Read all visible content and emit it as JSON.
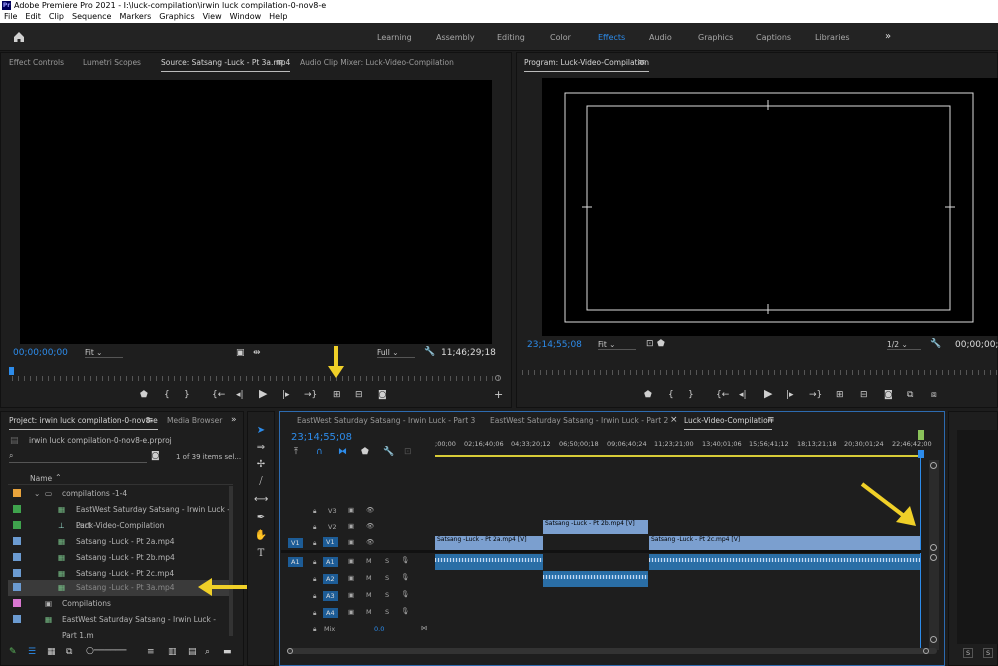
{
  "app": {
    "title": "Adobe Premiere Pro 2021 - I:\\luck-compilation\\irwin luck compilation-0-nov8-e"
  },
  "menu": [
    "File",
    "Edit",
    "Clip",
    "Sequence",
    "Markers",
    "Graphics",
    "View",
    "Window",
    "Help"
  ],
  "workspaces": [
    "Learning",
    "Assembly",
    "Editing",
    "Color",
    "Effects",
    "Audio",
    "Graphics",
    "Captions",
    "Libraries"
  ],
  "active_workspace": "Effects",
  "source_panel": {
    "tabs": [
      "Effect Controls",
      "Lumetri Scopes",
      "Source: Satsang -Luck - Pt 3a.mp4",
      "Audio Clip Mixer: Luck-Video-Compilation"
    ],
    "timecode_in": "00;00;00;00",
    "fit": "Fit",
    "quality": "Full",
    "duration": "11;46;29;18"
  },
  "program_panel": {
    "title": "Program: Luck-Video-Compilation",
    "timecode": "23;14;55;08",
    "fit": "Fit",
    "resolution": "1/2",
    "timecode_end": "00;00;00;"
  },
  "project_panel": {
    "tabs": [
      "Project: irwin luck compilation-0-nov8-e",
      "Media Browser"
    ],
    "project_file": "irwin luck compilation-0-nov8-e.prproj",
    "items_count": "1 of 39 items sel...",
    "col_name": "Name",
    "items": [
      {
        "label": "compilations -1-4",
        "color": "#e8a33c"
      },
      {
        "label": "EastWest Saturday Satsang - Irwin Luck - Part",
        "color": "#3fa34d"
      },
      {
        "label": "Luck-Video-Compilation",
        "color": "#3fa34d"
      },
      {
        "label": "Satsang -Luck - Pt 2a.mp4",
        "color": "#6b9bd1"
      },
      {
        "label": "Satsang -Luck - Pt 2b.mp4",
        "color": "#6b9bd1"
      },
      {
        "label": "Satsang -Luck - Pt 2c.mp4",
        "color": "#6b9bd1"
      },
      {
        "label": "Satsang -Luck - Pt 3a.mp4",
        "color": "#6b9bd1"
      },
      {
        "label": "Compilations",
        "color": "#d977d1"
      },
      {
        "label": "EastWest Saturday Satsang - Irwin Luck - Part 1.m",
        "color": "#6b9bd1"
      }
    ]
  },
  "timeline": {
    "tabs": [
      "EastWest Saturday Satsang - Irwin Luck - Part 3",
      "EastWest Saturday Satsang - Irwin Luck - Part 2",
      "Luck-Video-Compilation"
    ],
    "timecode": "23;14;55;08",
    "ruler": [
      ";00;00",
      "02;16;40;06",
      "04;33;20;12",
      "06;50;00;18",
      "09;06;40;24",
      "11;23;21;00",
      "13;40;01;06",
      "15;56;41;12",
      "18;13;21;18",
      "20;30;01;24",
      "22;46;42;00"
    ],
    "video_tracks": [
      "V3",
      "V2",
      "V1"
    ],
    "audio_tracks": [
      "A1",
      "A2",
      "A3",
      "A4"
    ],
    "mix_label": "Mix",
    "mix_value": "0.0",
    "m": "M",
    "s": "S",
    "clips": {
      "v2": "Satsang -Luck - Pt 2b.mp4 [V]",
      "v1a": "Satsang -Luck - Pt 2a.mp4 [V]",
      "v1c": "Satsang -Luck - Pt 2c.mp4 [V]"
    }
  }
}
